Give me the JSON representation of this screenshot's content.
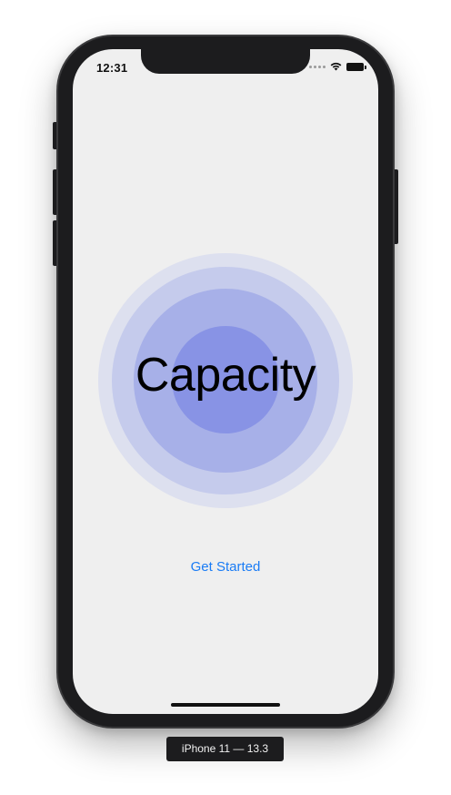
{
  "status_bar": {
    "time": "12:31",
    "icons": [
      "signal-dots-icon",
      "wifi-icon",
      "battery-icon"
    ]
  },
  "app": {
    "title": "Capacity",
    "get_started_label": "Get Started",
    "ring_colors": [
      "#dde0ef",
      "#c5cbec",
      "#a7b0e8",
      "#8893e5"
    ],
    "accent_color": "#1a7cf5"
  },
  "simulator": {
    "device_label": "iPhone 11 — 13.3"
  }
}
